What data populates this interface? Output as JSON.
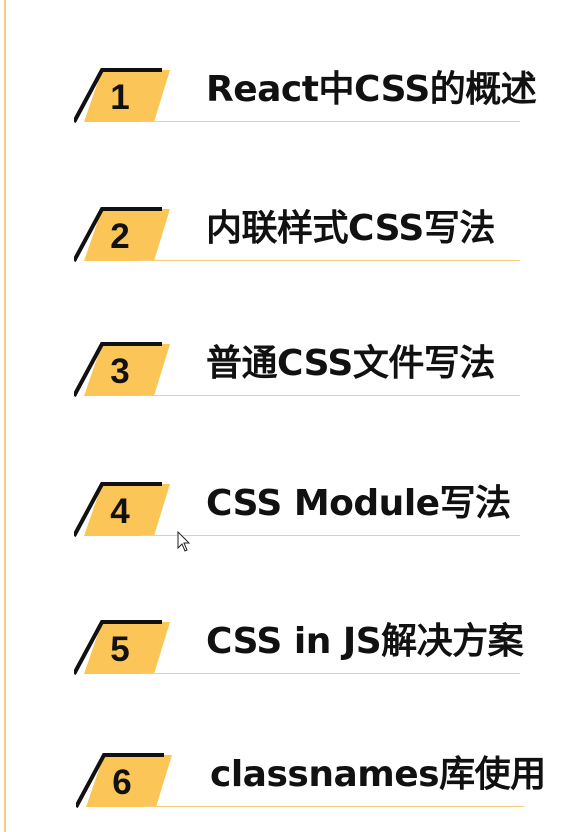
{
  "items": [
    {
      "number": "1",
      "label": "React中CSS的概述"
    },
    {
      "number": "2",
      "label": "内联样式CSS写法"
    },
    {
      "number": "3",
      "label": "普通CSS文件写法"
    },
    {
      "number": "4",
      "label": "CSS Module写法"
    },
    {
      "number": "5",
      "label": "CSS in JS解决方案"
    },
    {
      "number": "6",
      "label": "classnames库使用"
    }
  ],
  "colors": {
    "badge_fill": "#fcc557",
    "badge_stroke": "#111111",
    "underline": "#f2cf7e",
    "text": "#111111"
  }
}
